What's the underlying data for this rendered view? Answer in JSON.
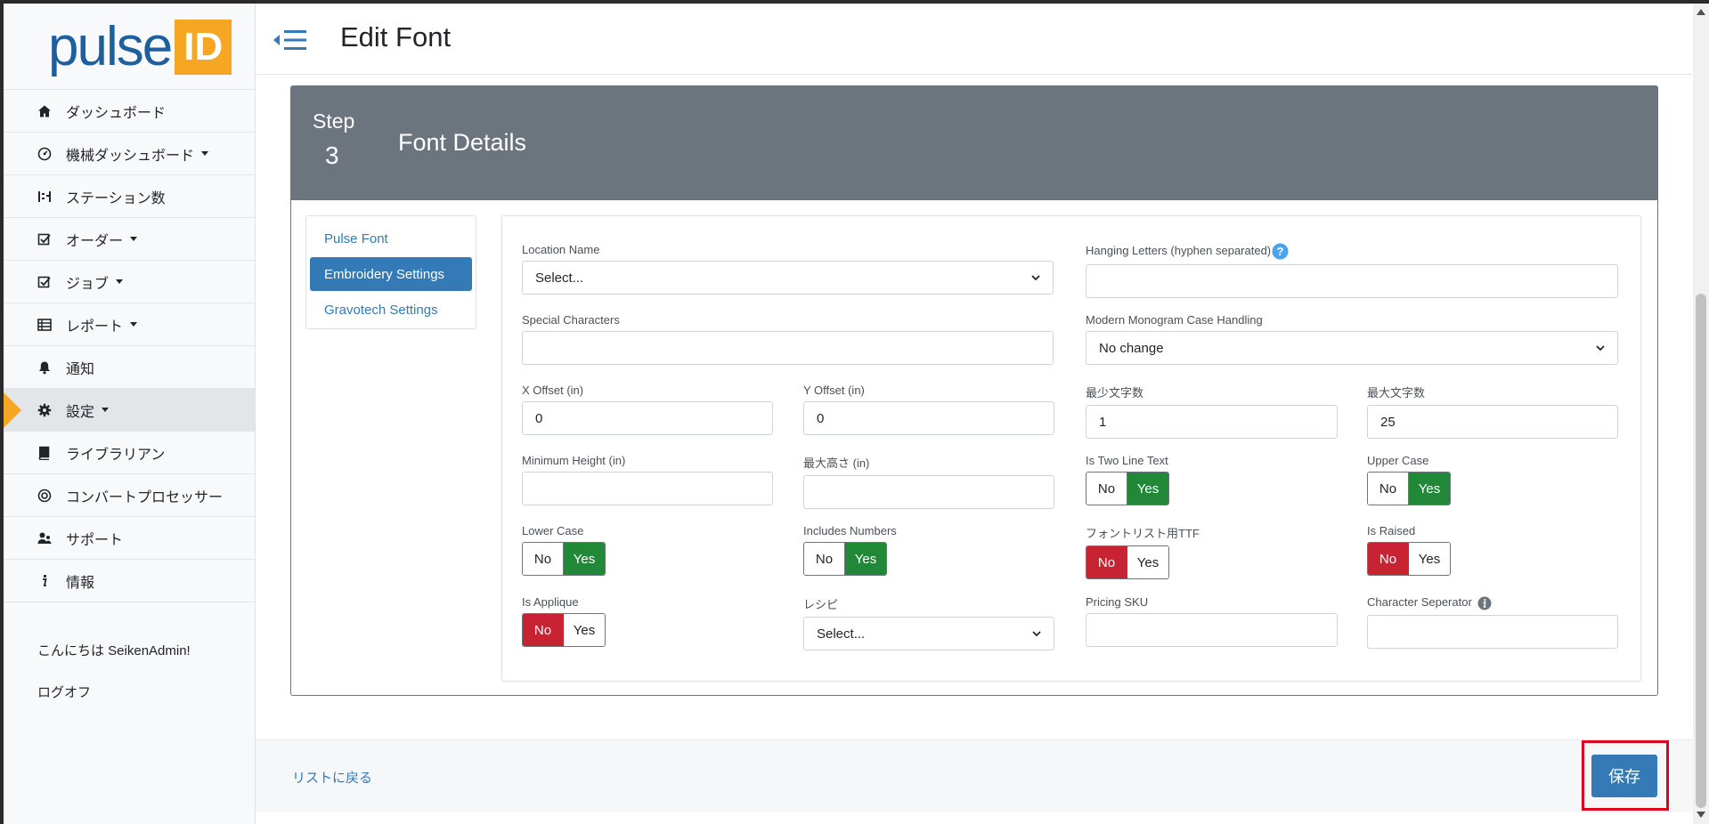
{
  "brand": {
    "name": "pulse",
    "badge": "ID",
    "color_primary": "#1f5f9e",
    "color_badge": "#f5a623"
  },
  "header": {
    "title": "Edit Font",
    "menu_icon": "back-hamburger-icon"
  },
  "sidebar": {
    "items": [
      {
        "label": "ダッシュボード",
        "icon": "home-icon",
        "dropdown": false
      },
      {
        "label": "機械ダッシュボード",
        "icon": "gauge-icon",
        "dropdown": true
      },
      {
        "label": "ステーション数",
        "icon": "stations-icon",
        "dropdown": false
      },
      {
        "label": "オーダー",
        "icon": "checkbox-icon",
        "dropdown": true
      },
      {
        "label": "ジョブ",
        "icon": "checkbox-icon",
        "dropdown": true
      },
      {
        "label": "レポート",
        "icon": "table-icon",
        "dropdown": true
      },
      {
        "label": "通知",
        "icon": "bell-icon",
        "dropdown": false
      },
      {
        "label": "設定",
        "icon": "gear-icon",
        "dropdown": true,
        "active": true
      },
      {
        "label": "ライブラリアン",
        "icon": "book-icon",
        "dropdown": false
      },
      {
        "label": "コンバートプロセッサー",
        "icon": "target-icon",
        "dropdown": false
      },
      {
        "label": "サポート",
        "icon": "support-icon",
        "dropdown": false
      },
      {
        "label": "情報",
        "icon": "info-icon",
        "dropdown": false
      }
    ],
    "greeting": "こんにちは SeikenAdmin!",
    "logout": "ログオフ"
  },
  "step": {
    "label": "Step",
    "number": "3",
    "title": "Font Details"
  },
  "tabs": [
    {
      "label": "Pulse Font",
      "active": false
    },
    {
      "label": "Embroidery Settings",
      "active": true
    },
    {
      "label": "Gravotech Settings",
      "active": false
    }
  ],
  "form": {
    "location_name": {
      "label": "Location Name",
      "value": "Select..."
    },
    "hanging_letters": {
      "label": "Hanging Letters (hyphen separated)",
      "value": ""
    },
    "special_characters": {
      "label": "Special Characters",
      "value": ""
    },
    "monogram_case": {
      "label": "Modern Monogram Case Handling",
      "value": "No change"
    },
    "x_offset": {
      "label": "X Offset (in)",
      "value": "0"
    },
    "y_offset": {
      "label": "Y Offset (in)",
      "value": "0"
    },
    "min_chars": {
      "label": "最少文字数",
      "value": "1"
    },
    "max_chars": {
      "label": "最大文字数",
      "value": "25"
    },
    "min_height": {
      "label": "Minimum Height (in)",
      "value": ""
    },
    "max_height": {
      "label": "最大高さ (in)",
      "value": ""
    },
    "two_line": {
      "label": "Is Two Line Text",
      "selected": "Yes"
    },
    "upper_case": {
      "label": "Upper Case",
      "selected": "Yes"
    },
    "lower_case": {
      "label": "Lower Case",
      "selected": "Yes"
    },
    "includes_numbers": {
      "label": "Includes Numbers",
      "selected": "Yes"
    },
    "font_list_ttf": {
      "label": "フォントリスト用TTF",
      "selected": "No"
    },
    "is_raised": {
      "label": "Is Raised",
      "selected": "No"
    },
    "is_applique": {
      "label": "Is Applique",
      "selected": "No"
    },
    "recipe": {
      "label": "レシピ",
      "value": "Select..."
    },
    "pricing_sku": {
      "label": "Pricing SKU",
      "value": ""
    },
    "char_separator": {
      "label": "Character Seperator",
      "value": ""
    },
    "toggle_no": "No",
    "toggle_yes": "Yes"
  },
  "footer": {
    "back_link": "リストに戻る",
    "save_label": "保存"
  },
  "colors": {
    "accent": "#337ab7",
    "step_header": "#6c757d",
    "yes_selected": "#218838",
    "no_selected": "#c82333",
    "highlight": "#e0001b"
  }
}
